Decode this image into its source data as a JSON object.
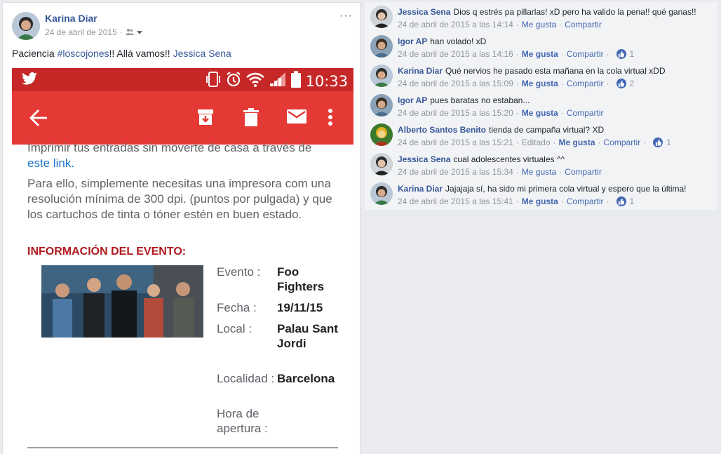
{
  "post": {
    "author": "Karina Diar",
    "date": "24 de abril de 2015",
    "audience_icon": "friends-icon",
    "text_prefix": "Paciencia ",
    "hashtag": "#loscojones",
    "text_middle": "!! Allá vamos!! ",
    "mention": "Jessica Sena",
    "more_label": "···"
  },
  "screenshot": {
    "time": "10:33",
    "email_line1": "Imprimir tus entradas sin moverte de casa a través de",
    "email_link": "este link.",
    "email_para": "Para ello, simplemente necesitas una impresora com una resolución mínima de 300 dpi. (puntos por pulgada) y que los cartuchos de tinta o tóner estén en buen estado.",
    "event_title": "INFORMACIÓN DEL EVENTO:",
    "rows": [
      {
        "key": "Evento :",
        "value": "Foo Fighters"
      },
      {
        "key": "Fecha :",
        "value": "19/11/15"
      },
      {
        "key": "Local :",
        "value": "Palau Sant Jordi"
      },
      {
        "key": "Localidad :",
        "value": "Barcelona"
      },
      {
        "key": "Hora de apertura :",
        "value": ""
      }
    ],
    "colors": {
      "status": "#c62828",
      "appbar": "#e53935",
      "title": "#b0191e"
    }
  },
  "comments": [
    {
      "name": "Jessica Sena",
      "text": "Dios q estrés pa pillarlas! xD pero ha valido la pena!! qué ganas!!",
      "time": "24 de abril de 2015 a las 14:14",
      "edited": "",
      "like": "Me gusta",
      "share": "Compartir",
      "likes": "",
      "liked": false
    },
    {
      "name": "Igor AP",
      "text": "han volado! xD",
      "time": "24 de abril de 2015 a las 14:16",
      "edited": "",
      "like": "Me gusta",
      "share": "Compartir",
      "likes": "1",
      "liked": true
    },
    {
      "name": "Karina Diar",
      "text": "Qué nervios he pasado esta mañana en la cola virtual xDD",
      "time": "24 de abril de 2015 a las 15:09",
      "edited": "",
      "like": "Me gusta",
      "share": "Compartir",
      "likes": "2",
      "liked": true
    },
    {
      "name": "Igor AP",
      "text": "pues baratas no estaban...",
      "time": "24 de abril de 2015 a las 15:20",
      "edited": "",
      "like": "Me gusta",
      "share": "Compartir",
      "likes": "",
      "liked": true
    },
    {
      "name": "Alberto Santos Benito",
      "text": "tienda de campaña virtual? XD",
      "time": "24 de abril de 2015 a las 15:21",
      "edited": "Editado",
      "like": "Me gusta",
      "share": "Compartir",
      "likes": "1",
      "liked": true
    },
    {
      "name": "Jessica Sena",
      "text": "cual adolescentes virtuales ^^",
      "time": "24 de abril de 2015 a las 15:34",
      "edited": "",
      "like": "Me gusta",
      "share": "Compartir",
      "likes": "",
      "liked": false
    },
    {
      "name": "Karina Diar",
      "text": "Jajajaja sí, ha sido mi primera cola virtual y espero que la última!",
      "time": "24 de abril de 2015 a las 15:41",
      "edited": "",
      "like": "Me gusta",
      "share": "Compartir",
      "likes": "1",
      "liked": true
    }
  ]
}
